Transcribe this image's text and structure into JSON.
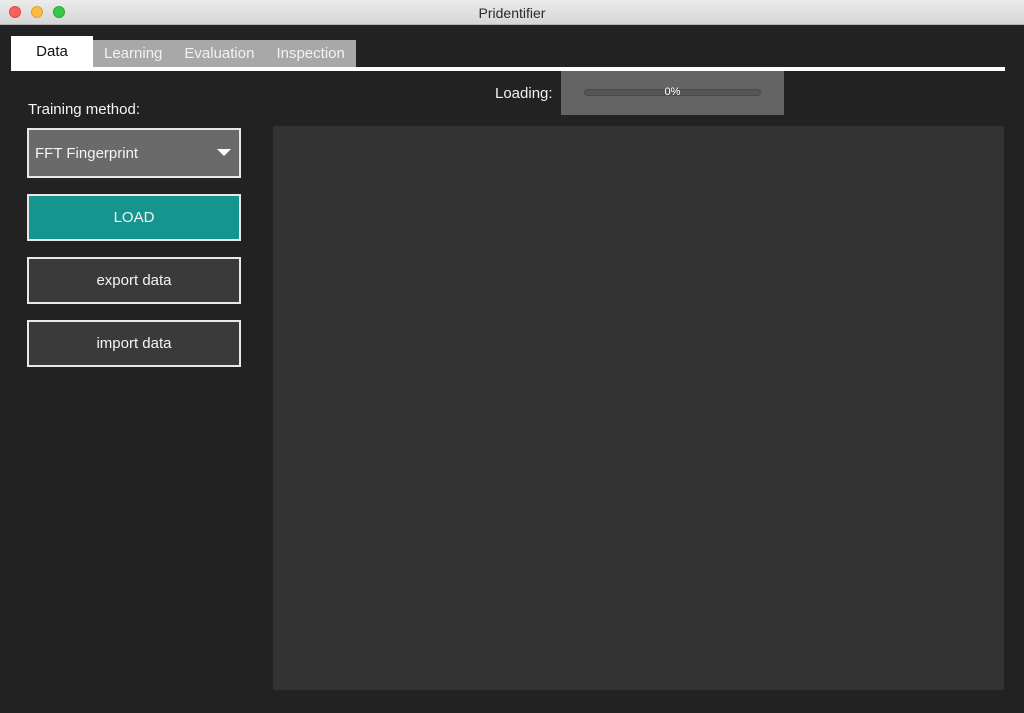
{
  "window": {
    "title": "Pridentifier"
  },
  "tabs": [
    {
      "label": "Data",
      "active": true
    },
    {
      "label": "Learning",
      "active": false
    },
    {
      "label": "Evaluation",
      "active": false
    },
    {
      "label": "Inspection",
      "active": false
    }
  ],
  "loading": {
    "label": "Loading:",
    "progress_text": "0%",
    "progress_fraction": 0
  },
  "training": {
    "label": "Training method:",
    "selected_method": "FFT Fingerprint",
    "dropdown_icon": "chevron-down-icon"
  },
  "buttons": {
    "load": "LOAD",
    "export": "export data",
    "import": "import data"
  },
  "colors": {
    "accent": "#16958f",
    "background": "#222222",
    "canvas": "#333333"
  }
}
